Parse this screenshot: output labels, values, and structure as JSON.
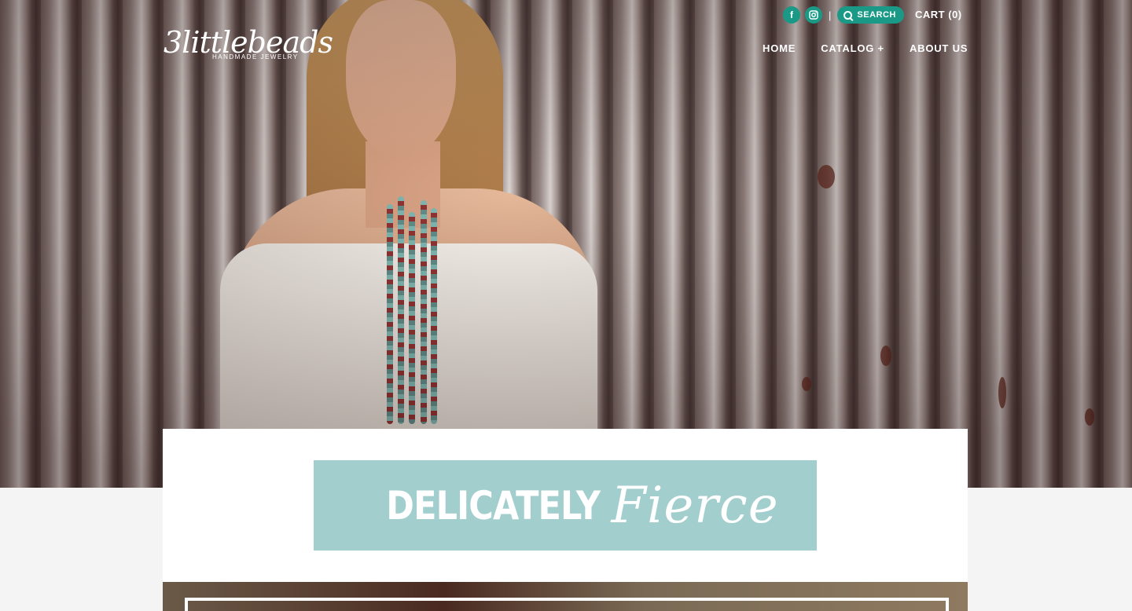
{
  "brand": {
    "logo_script": "3littlebeads",
    "logo_tagline": "HANDMADE JEWELRY"
  },
  "topbar": {
    "facebook_icon": "facebook-icon",
    "instagram_icon": "instagram-icon",
    "separator": "|",
    "search_label": "SEARCH",
    "cart_label": "CART (0)"
  },
  "nav": {
    "items": [
      "HOME",
      "CATALOG +",
      "ABOUT US"
    ]
  },
  "banner": {
    "text_bold": "DELICATELY",
    "text_script": "Fierce"
  },
  "colors": {
    "accent": "#1a9a86",
    "banner_bg": "#a2cfcd"
  }
}
